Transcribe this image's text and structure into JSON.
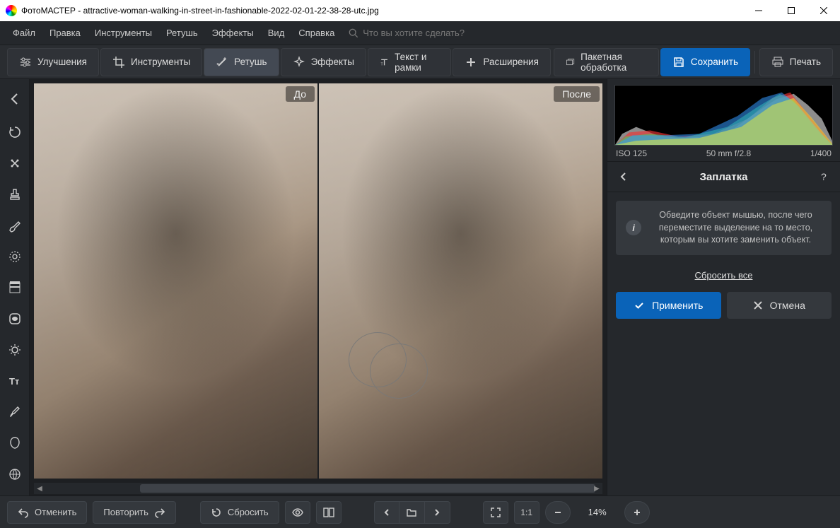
{
  "titlebar": {
    "app_name": "ФотоМАСТЕР",
    "separator": " - ",
    "filename": "attractive-woman-walking-in-street-in-fashionable-2022-02-01-22-38-28-utc.jpg"
  },
  "menu": {
    "file": "Файл",
    "edit": "Правка",
    "tools": "Инструменты",
    "retouch": "Ретушь",
    "effects": "Эффекты",
    "view": "Вид",
    "help": "Справка",
    "search_placeholder": "Что вы хотите сделать?"
  },
  "toolbar": {
    "enhance": "Улучшения",
    "tools": "Инструменты",
    "retouch": "Ретушь",
    "effects": "Эффекты",
    "text_frames": "Текст и рамки",
    "extensions": "Расширения",
    "batch": "Пакетная обработка",
    "save": "Сохранить",
    "print": "Печать"
  },
  "canvas": {
    "before_label": "До",
    "after_label": "После"
  },
  "exif": {
    "iso": "ISO 125",
    "lens": "50 mm f/2.8",
    "shutter": "1/400"
  },
  "panel": {
    "title": "Заплатка",
    "info_text": "Обведите объект мышью, после чего переместите выделение на то место, которым вы хотите заменить объект.",
    "reset_all": "Сбросить все",
    "apply": "Применить",
    "cancel": "Отмена"
  },
  "bottombar": {
    "undo": "Отменить",
    "redo": "Повторить",
    "reset": "Сбросить",
    "ratio": "1:1",
    "zoom_pct": "14%"
  }
}
